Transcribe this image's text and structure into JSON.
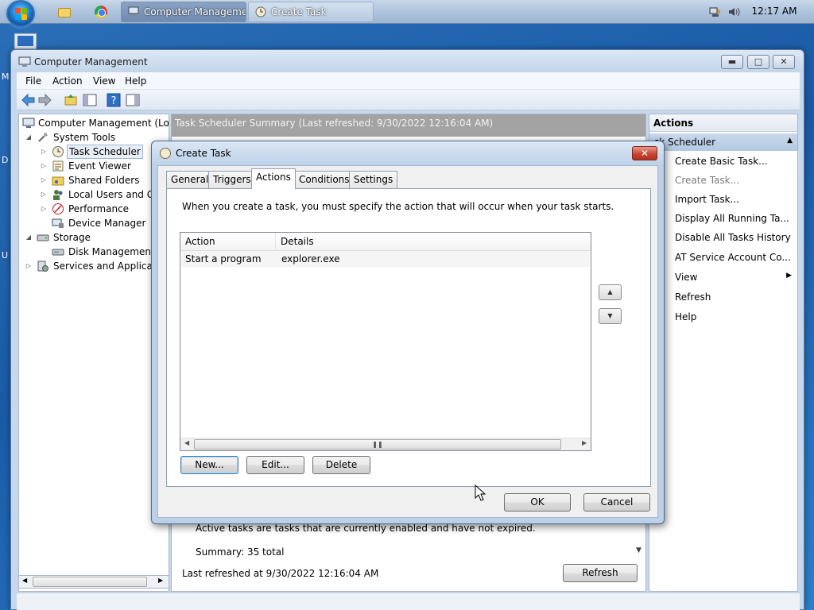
{
  "taskbar": {
    "tasks": [
      {
        "label": "Computer Manageme..."
      },
      {
        "label": "Create Task"
      }
    ],
    "clock": "12:17 AM"
  },
  "desktop": {
    "letters": [
      "M",
      "D",
      "U"
    ]
  },
  "window": {
    "title": "Computer Management",
    "menu": [
      "File",
      "Action",
      "View",
      "Help"
    ],
    "tree": [
      {
        "label": "Computer Management (Local",
        "icon": "computer-icon",
        "level": 0
      },
      {
        "label": "System Tools",
        "icon": "tools-icon",
        "level": 1,
        "expanded": true
      },
      {
        "label": "Task Scheduler",
        "icon": "clock-icon",
        "level": 2,
        "selected": true
      },
      {
        "label": "Event Viewer",
        "icon": "event-viewer-icon",
        "level": 2
      },
      {
        "label": "Shared Folders",
        "icon": "shared-folder-icon",
        "level": 2
      },
      {
        "label": "Local Users and Gro",
        "icon": "users-icon",
        "level": 2
      },
      {
        "label": "Performance",
        "icon": "performance-icon",
        "level": 2
      },
      {
        "label": "Device Manager",
        "icon": "device-manager-icon",
        "level": 2
      },
      {
        "label": "Storage",
        "icon": "storage-icon",
        "level": 1,
        "expanded": true
      },
      {
        "label": "Disk Management",
        "icon": "disk-icon",
        "level": 2
      },
      {
        "label": "Services and Application",
        "icon": "services-icon",
        "level": 1
      }
    ],
    "center": {
      "header": "Task Scheduler Summary (Last refreshed: 9/30/2022 12:16:04 AM)",
      "active_desc": "Active tasks are tasks that are currently enabled and have not expired.",
      "summary": "Summary: 35 total",
      "last_refreshed": "Last refreshed at 9/30/2022 12:16:04 AM",
      "refresh_label": "Refresh"
    },
    "actions_pane": {
      "header": "Actions",
      "section": "sk Scheduler",
      "items": [
        {
          "label": "Create Basic Task...",
          "icon": "create-basic-task-icon",
          "enabled": true
        },
        {
          "label": "Create Task...",
          "icon": "create-task-icon",
          "enabled": false
        },
        {
          "label": "Import Task...",
          "icon": "import-icon",
          "enabled": true
        },
        {
          "label": "Display All Running Ta...",
          "icon": "running-tasks-icon",
          "enabled": true
        },
        {
          "label": "Disable All Tasks History",
          "icon": "history-icon",
          "enabled": true
        },
        {
          "label": "AT Service Account Co...",
          "icon": "account-icon",
          "enabled": true
        },
        {
          "label": "View",
          "icon": "view-icon",
          "enabled": true,
          "submenu": true
        },
        {
          "label": "Refresh",
          "icon": "refresh-icon",
          "enabled": true
        },
        {
          "label": "Help",
          "icon": "help-icon",
          "enabled": true
        }
      ]
    }
  },
  "dialog": {
    "title": "Create Task",
    "tabs": [
      "General",
      "Triggers",
      "Actions",
      "Conditions",
      "Settings"
    ],
    "active_tab": "Actions",
    "description": "When you create a task, you must specify the action that will occur when your task starts.",
    "columns": [
      "Action",
      "Details"
    ],
    "rows": [
      {
        "action": "Start a program",
        "details": "explorer.exe"
      }
    ],
    "buttons": {
      "new": "New...",
      "edit": "Edit...",
      "delete": "Delete",
      "ok": "OK",
      "cancel": "Cancel"
    }
  },
  "colors": {
    "desktop": "#1a5aa6",
    "center_header_bg": "#a3a3a3",
    "dialog_close": "#c4402d",
    "actions_section_bg": "#b3c9e3"
  }
}
